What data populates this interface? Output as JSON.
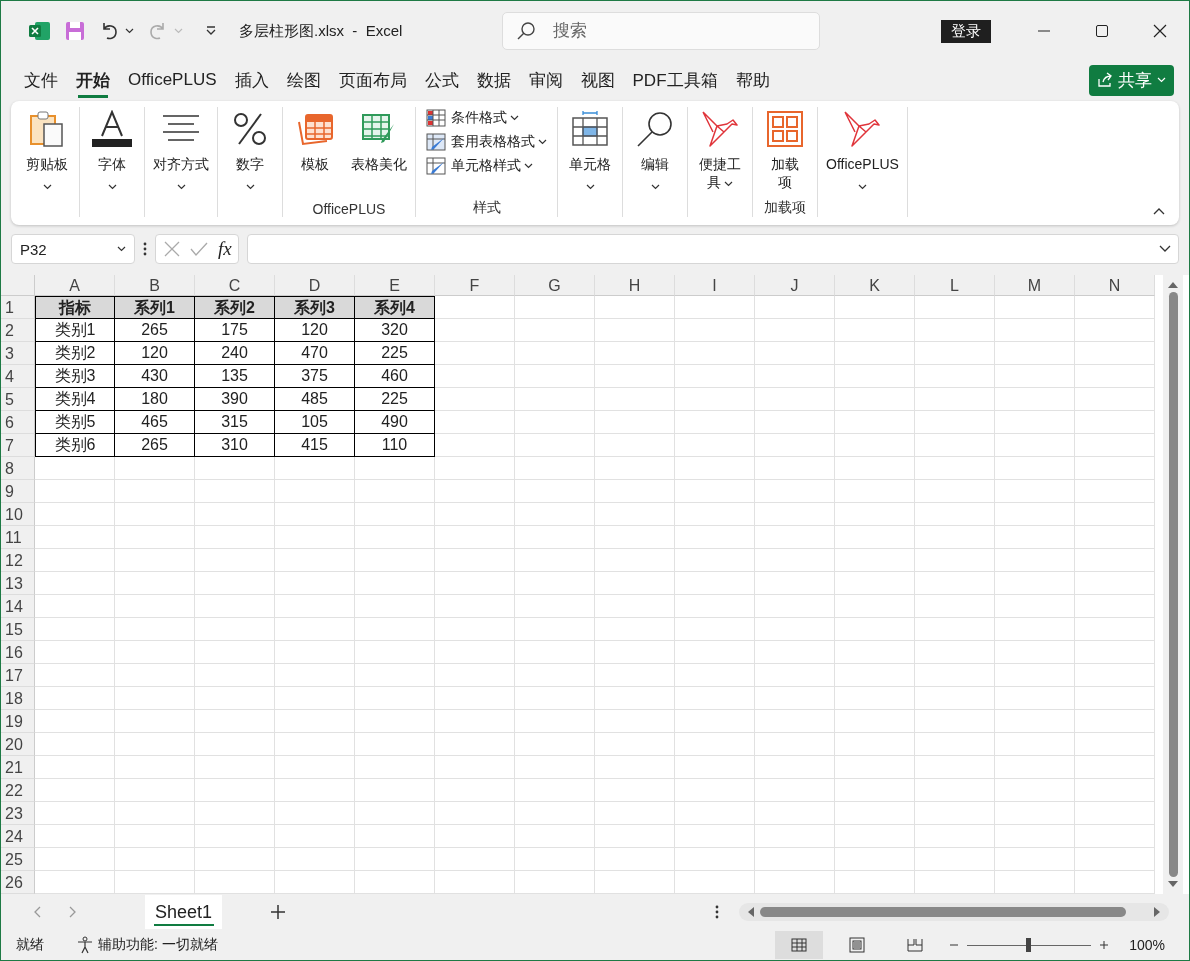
{
  "window": {
    "title": "多层柱形图.xlsx  -  Excel",
    "search": {
      "placeholder": "搜索"
    },
    "sign_in": "登录",
    "redo_disabled": true
  },
  "menu_tabs": [
    {
      "label": "文件",
      "selected": false
    },
    {
      "label": "开始",
      "selected": true
    },
    {
      "label": "OfficePLUS",
      "selected": false
    },
    {
      "label": "插入",
      "selected": false
    },
    {
      "label": "绘图",
      "selected": false
    },
    {
      "label": "页面布局",
      "selected": false
    },
    {
      "label": "公式",
      "selected": false
    },
    {
      "label": "数据",
      "selected": false
    },
    {
      "label": "审阅",
      "selected": false
    },
    {
      "label": "视图",
      "selected": false
    },
    {
      "label": "PDF工具箱",
      "selected": false
    },
    {
      "label": "帮助",
      "selected": false
    }
  ],
  "share_button": "共享",
  "ribbon_groups": [
    {
      "commands": [
        {
          "kind": "large",
          "label": "剪贴板",
          "dropdown": true
        }
      ]
    },
    {
      "commands": [
        {
          "kind": "large",
          "label": "字体",
          "dropdown": true
        }
      ]
    },
    {
      "commands": [
        {
          "kind": "large",
          "label": "对齐方式",
          "dropdown": true
        }
      ]
    },
    {
      "commands": [
        {
          "kind": "large",
          "label": "数字",
          "dropdown": true
        }
      ]
    },
    {
      "label": "OfficePLUS",
      "commands": [
        {
          "kind": "large",
          "label": "模板",
          "dropdown": false
        },
        {
          "kind": "large",
          "label": "表格美化",
          "dropdown": false
        }
      ]
    },
    {
      "label": "样式",
      "commands": [
        {
          "kind": "small",
          "label": "条件格式",
          "dropdown": true
        },
        {
          "kind": "small",
          "label": "套用表格格式",
          "dropdown": true
        },
        {
          "kind": "small",
          "label": "单元格样式",
          "dropdown": true
        }
      ]
    },
    {
      "commands": [
        {
          "kind": "large",
          "label": "单元格",
          "dropdown": true
        }
      ]
    },
    {
      "commands": [
        {
          "kind": "large",
          "label": "编辑",
          "dropdown": true
        }
      ]
    },
    {
      "commands": [
        {
          "kind": "large",
          "label": "便捷工具",
          "dropdown": true
        }
      ]
    },
    {
      "label": "加载项",
      "commands": [
        {
          "kind": "large",
          "label": "加载项",
          "dropdown": false
        }
      ]
    },
    {
      "commands": [
        {
          "kind": "large",
          "label": "OfficePLUS",
          "dropdown": true
        }
      ]
    }
  ],
  "formula_bar": {
    "name_box": "P32",
    "function_button": "fx"
  },
  "sheet": {
    "column_headers": [
      "A",
      "B",
      "C",
      "D",
      "E",
      "F",
      "G",
      "H",
      "I",
      "J",
      "K",
      "L",
      "M",
      "N"
    ],
    "row_headers": [
      "1",
      "2",
      "3",
      "4",
      "5",
      "6",
      "7",
      "8",
      "9",
      "10",
      "11",
      "12",
      "13",
      "14",
      "15",
      "16",
      "17",
      "18",
      "19",
      "20",
      "21",
      "22",
      "23",
      "24",
      "25",
      "26"
    ],
    "table": {
      "header": [
        "指标",
        "系列1",
        "系列2",
        "系列3",
        "系列4"
      ],
      "rows": [
        [
          "类别1",
          "265",
          "175",
          "120",
          "320"
        ],
        [
          "类别2",
          "120",
          "240",
          "470",
          "225"
        ],
        [
          "类别3",
          "430",
          "135",
          "375",
          "460"
        ],
        [
          "类别4",
          "180",
          "390",
          "485",
          "225"
        ],
        [
          "类别5",
          "465",
          "315",
          "105",
          "490"
        ],
        [
          "类别6",
          "265",
          "310",
          "415",
          "110"
        ]
      ]
    }
  },
  "sheet_tabs": [
    {
      "label": "Sheet1",
      "selected": true
    }
  ],
  "status_bar": {
    "ready": "就绪",
    "accessibility": "辅助功能: 一切就绪",
    "views": [
      {
        "selected": true
      },
      {
        "selected": false
      },
      {
        "selected": false
      }
    ],
    "zoom_slider": {
      "level": 0.5
    },
    "zoom_reading": "100%"
  }
}
